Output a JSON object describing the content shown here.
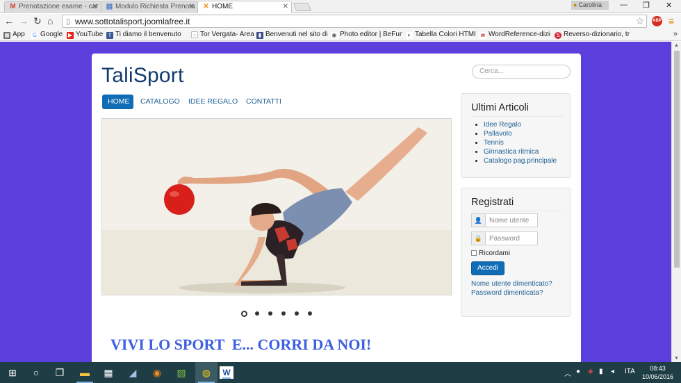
{
  "browser": {
    "tabs": [
      {
        "icon": "M",
        "icon_color": "#d44638",
        "label": "Prenotazione esame - car",
        "active": false
      },
      {
        "icon": "▤",
        "icon_color": "#4a73c4",
        "label": "Modulo Richiesta Prenota",
        "active": false
      },
      {
        "icon": "✕",
        "icon_color": "#f28f1c",
        "label": "HOME",
        "active": true
      }
    ],
    "profile_name": "Carolina",
    "url": "www.sottotalisport.joomlafree.it",
    "bookmarks": [
      {
        "label": "App",
        "icon_color": "#6d6d6d",
        "icon": "⋮"
      },
      {
        "label": "Google",
        "icon_color": "#4285f4",
        "icon": "G"
      },
      {
        "label": "YouTube",
        "icon_color": "#e62117",
        "icon": "▶"
      },
      {
        "label": "Ti diamo il benvenuto",
        "icon_color": "#3b5998",
        "icon": "f"
      },
      {
        "label": "Tor Vergata- Area Stu",
        "icon_color": "#8a8a8a",
        "icon": "▫"
      },
      {
        "label": "Benvenuti nel sito di I",
        "icon_color": "#3a4d86",
        "icon": "▮"
      },
      {
        "label": "Photo editor | BeFunk",
        "icon_color": "#555555",
        "icon": "◉"
      },
      {
        "label": "Tabella Colori HTML e",
        "icon_color": "#333333",
        "icon": "◐"
      },
      {
        "label": "WordReference-dizion",
        "icon_color": "#c1272d",
        "icon": "w"
      },
      {
        "label": "Reverso-dizionario, tr",
        "icon_color": "#d3202f",
        "icon": "S"
      }
    ]
  },
  "site": {
    "brand": "TaliSport",
    "search_placeholder": "Cerca...",
    "nav": [
      "HOME",
      "CATALOGO",
      "IDEE REGALO",
      "CONTATTI"
    ],
    "slide_count": 6,
    "active_slide": 1,
    "slogan": "VIVI LO SPORT  E... CORRI DA NOI!",
    "articles": {
      "title": "Ultimi Articoli",
      "items": [
        "Idee Regalo",
        "Pallavolo",
        "Tennis",
        "Ginnastica ritmica",
        "Catalogo pag.principale"
      ]
    },
    "login": {
      "title": "Registrati",
      "username_placeholder": "Nome utente",
      "password_placeholder": "Password",
      "remember_label": "Ricordami",
      "submit_label": "Accedi",
      "forgot_username": "Nome utente dimenticato?",
      "forgot_password": "Password dimenticata?"
    }
  },
  "taskbar": {
    "language": "ITA",
    "time": "08:43",
    "date": "10/06/2016"
  }
}
